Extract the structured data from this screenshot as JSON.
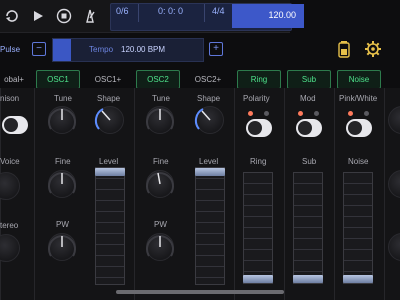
{
  "transport": {
    "position": "0/6",
    "time": "0: 0: 0",
    "signature": "4/4",
    "tempo_value": "120.00"
  },
  "preset": {
    "name": "Pulse",
    "tempo_label": "Tempo",
    "tempo_value": "120.00 BPM",
    "minus_label": "−",
    "plus_label": "+"
  },
  "tabs": [
    {
      "label": "obal+",
      "active": false
    },
    {
      "label": "OSC1",
      "active": true
    },
    {
      "label": "OSC1+",
      "active": false
    },
    {
      "label": "OSC2",
      "active": true
    },
    {
      "label": "OSC2+",
      "active": false
    },
    {
      "label": "Ring",
      "active": true
    },
    {
      "label": "Sub",
      "active": true
    },
    {
      "label": "Noise",
      "active": true
    }
  ],
  "global": {
    "unison": "nison",
    "voice": "Voice",
    "stereo": "tereo"
  },
  "osc1": {
    "tune": "Tune",
    "fine": "Fine",
    "pw": "PW",
    "shape": "Shape",
    "level": "Level",
    "level_value": 1.0
  },
  "osc2": {
    "tune": "Tune",
    "fine": "Fine",
    "pw": "PW",
    "shape": "Shape",
    "level": "Level",
    "level_value": 1.0
  },
  "ring": {
    "polarity": "Polarity",
    "label": "Ring",
    "level_value": 0.0
  },
  "sub": {
    "mod": "Mod",
    "label": "Sub",
    "level_value": 0.0
  },
  "noise": {
    "type": "Pink/White",
    "label": "Noise",
    "level_value": 0.0
  },
  "colors": {
    "accent": "#4ee28b",
    "blue": "#3d58c9",
    "knob_arc": "#5d8dff",
    "dot_on": "#ff7a5c"
  }
}
